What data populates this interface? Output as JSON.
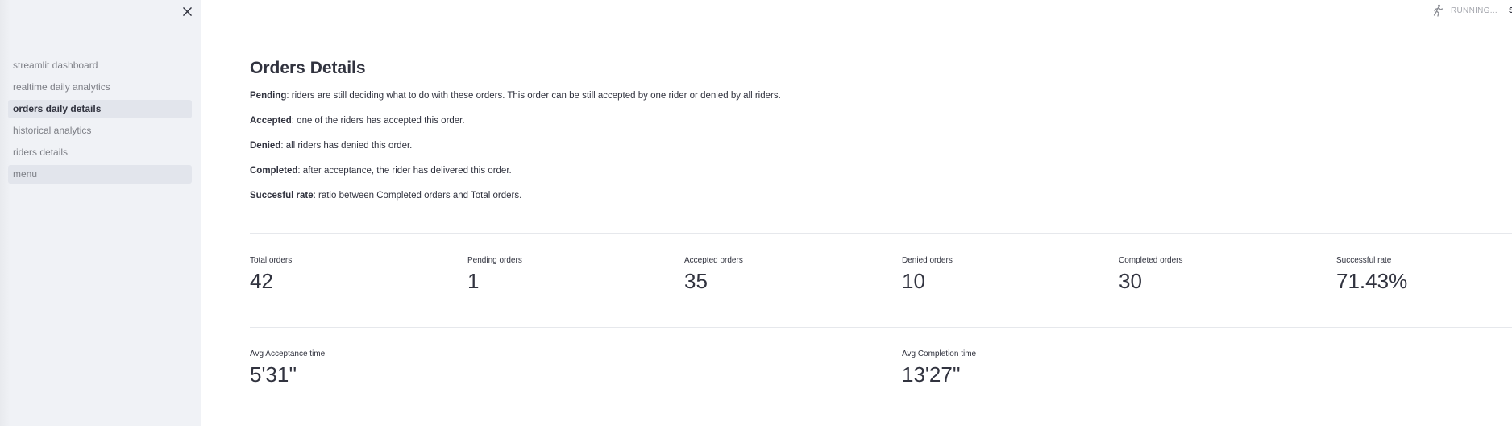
{
  "sidebar": {
    "close_icon": "close-icon",
    "items": [
      {
        "label": "streamlit dashboard"
      },
      {
        "label": "realtime daily analytics"
      },
      {
        "label": "orders daily details",
        "active": true
      },
      {
        "label": "historical analytics"
      },
      {
        "label": "riders details"
      },
      {
        "label": "menu"
      }
    ]
  },
  "status": {
    "icon": "running-man-icon",
    "text": "RUNNING...",
    "stop_label": "St"
  },
  "main": {
    "title": "Orders Details",
    "definitions": [
      {
        "term": "Pending",
        "text": ": riders are still deciding what to do with these orders. This order can be still accepted by one rider or denied by all riders."
      },
      {
        "term": "Accepted",
        "text": ": one of the riders has accepted this order."
      },
      {
        "term": "Denied",
        "text": ": all riders has denied this order."
      },
      {
        "term": "Completed",
        "text": ": after acceptance, the rider has delivered this order."
      },
      {
        "term": "Succesful rate",
        "text": ": ratio between Completed orders and Total orders."
      }
    ],
    "metrics_row1": [
      {
        "label": "Total orders",
        "value": "42"
      },
      {
        "label": "Pending orders",
        "value": "1"
      },
      {
        "label": "Accepted orders",
        "value": "35"
      },
      {
        "label": "Denied orders",
        "value": "10"
      },
      {
        "label": "Completed orders",
        "value": "30"
      },
      {
        "label": "Successful rate",
        "value": "71.43%"
      }
    ],
    "metrics_row2": [
      {
        "label": "Avg Acceptance time",
        "value": "5'31''"
      },
      {
        "label": "Avg Completion time",
        "value": "13'27''"
      }
    ]
  },
  "colors": {
    "sidebar_bg": "#f0f2f6",
    "active_item_bg": "#e2e5ec",
    "text": "#31333f",
    "muted_text": "#7d7f86"
  }
}
